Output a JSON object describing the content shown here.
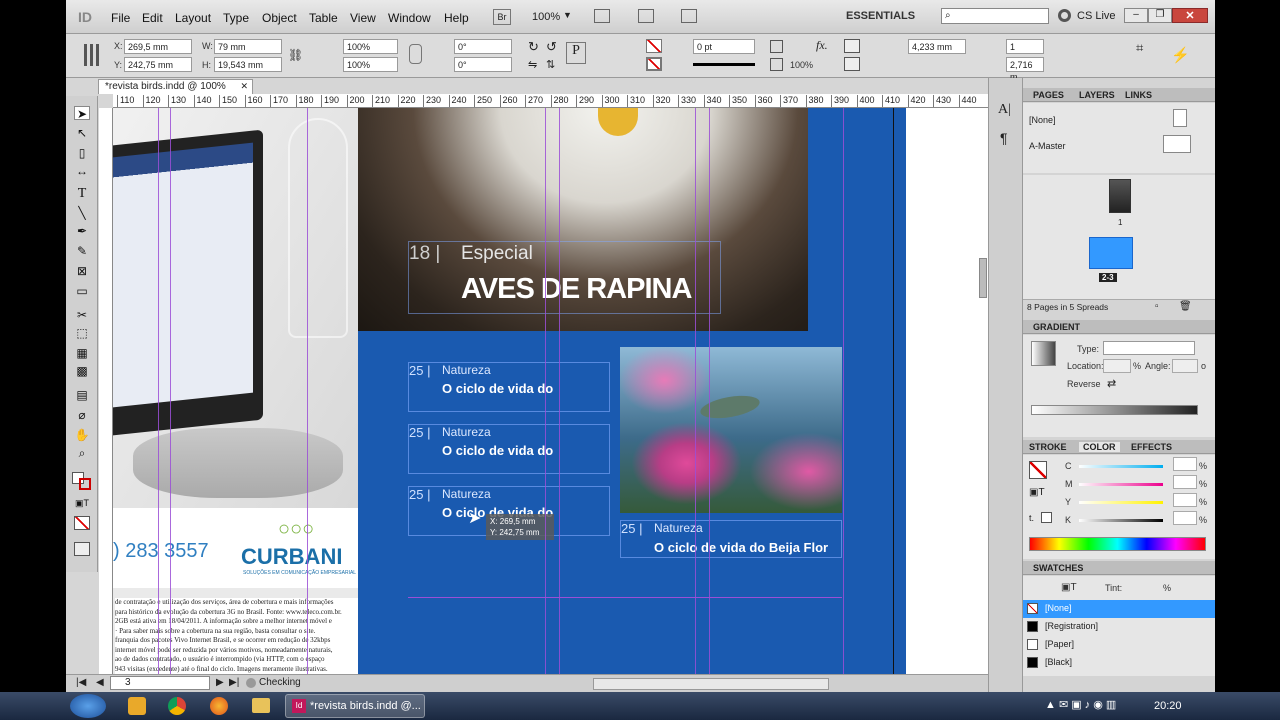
{
  "app": {
    "logo": "ID"
  },
  "menu": [
    "File",
    "Edit",
    "Layout",
    "Type",
    "Object",
    "Table",
    "View",
    "Window",
    "Help"
  ],
  "menubar_right": {
    "bridge": "Br",
    "zoom": "100%",
    "workspace": "ESSENTIALS",
    "cs_live": "CS Live"
  },
  "control": {
    "x": "269,5 mm",
    "y": "242,75 mm",
    "w": "79 mm",
    "h": "19,543 mm",
    "scale_x": "100%",
    "scale_y": "100%",
    "rotate": "0°",
    "shear": "0°",
    "stroke_weight": "0 pt",
    "opacity": "100%",
    "gap": "4,233 mm",
    "columns": "1",
    "gutter": "2,716 m"
  },
  "document_tab": "*revista birds.indd @ 100%",
  "ruler_ticks": [
    "110",
    "120",
    "130",
    "140",
    "150",
    "160",
    "170",
    "180",
    "190",
    "200",
    "210",
    "220",
    "230",
    "240",
    "250",
    "260",
    "270",
    "280",
    "290",
    "300",
    "310",
    "320",
    "330",
    "340",
    "350",
    "360",
    "370",
    "380",
    "390",
    "400",
    "410",
    "420",
    "430",
    "440"
  ],
  "left_page": {
    "phone": ") 283 3557",
    "brand": "CURBANI",
    "tagline": "SOLUÇÕES EM COMUNICAÇÃO EMPRESARIAL",
    "body_lines": [
      "de contratação e utilização dos serviços, área de cobertura e mais informações",
      "para histórico da evolução da cobertura 3G no Brasil. Fonte: www.teleco.com.br.",
      "2GB está ativa em 18/04/2011. A informação sobre a melhor internet móvel e",
      "· Para saber mais sobre a cobertura na sua região, basta consultar o site.",
      "franquia dos pacotes Vivo Internet Brasil, e se ocorrer em redução de 32kbps",
      "internet móvel pode ser reduzida por vários motivos, nomeadamente naturais,",
      "ao de dados contratado, o usuário é interrompido (via HTTP, com o espaço",
      "943 visitas (excedente) até o final do ciclo. Imagens meramente ilustrativas."
    ]
  },
  "spread": {
    "feature_num": "18 |",
    "feature_section": "Especial",
    "feature_title": "AVES DE RAPINA",
    "toc": [
      {
        "num": "25 |",
        "section": "Natureza",
        "title": "O ciclo de vida do"
      },
      {
        "num": "25 |",
        "section": "Natureza",
        "title": "O ciclo de vida do"
      },
      {
        "num": "25 |",
        "section": "Natureza",
        "title": "O ciclo de vida do"
      }
    ],
    "caption": {
      "num": "25 |",
      "section": "Natureza",
      "title": "O ciclo de vida do Beija Flor"
    },
    "tooltip": {
      "x": "X: 269,5 mm",
      "y": "Y: 242,75 mm"
    }
  },
  "status": {
    "page": "3",
    "preflight": "Checking"
  },
  "pages_panel": {
    "tabs": [
      "PAGES",
      "LAYERS",
      "LINKS"
    ],
    "masters": [
      "[None]",
      "A-Master"
    ],
    "page_labels": [
      "1",
      "2-3"
    ],
    "summary": "8 Pages in 5 Spreads"
  },
  "gradient_panel": {
    "title": "GRADIENT",
    "type_label": "Type:",
    "location_label": "Location:",
    "angle_label": "Angle:",
    "reverse_label": "Reverse",
    "percent": "%",
    "degree": "o"
  },
  "color_panel": {
    "tabs": [
      "STROKE",
      "COLOR",
      "EFFECTS"
    ],
    "channels": [
      "C",
      "M",
      "Y",
      "K"
    ],
    "percent": "%"
  },
  "swatches_panel": {
    "title": "SWATCHES",
    "tint_label": "Tint:",
    "percent": "%",
    "items": [
      {
        "name": "[None]",
        "color": "#ffffff"
      },
      {
        "name": "[Registration]",
        "color": "#000000"
      },
      {
        "name": "[Paper]",
        "color": "#ffffff"
      },
      {
        "name": "[Black]",
        "color": "#000000"
      }
    ]
  },
  "taskbar": {
    "task": "*revista birds.indd @...",
    "clock": "20:20"
  },
  "colors": {
    "accent_blue": "#1a5ab0",
    "guide": "#9b4fd6",
    "selection": "#3399ff"
  }
}
